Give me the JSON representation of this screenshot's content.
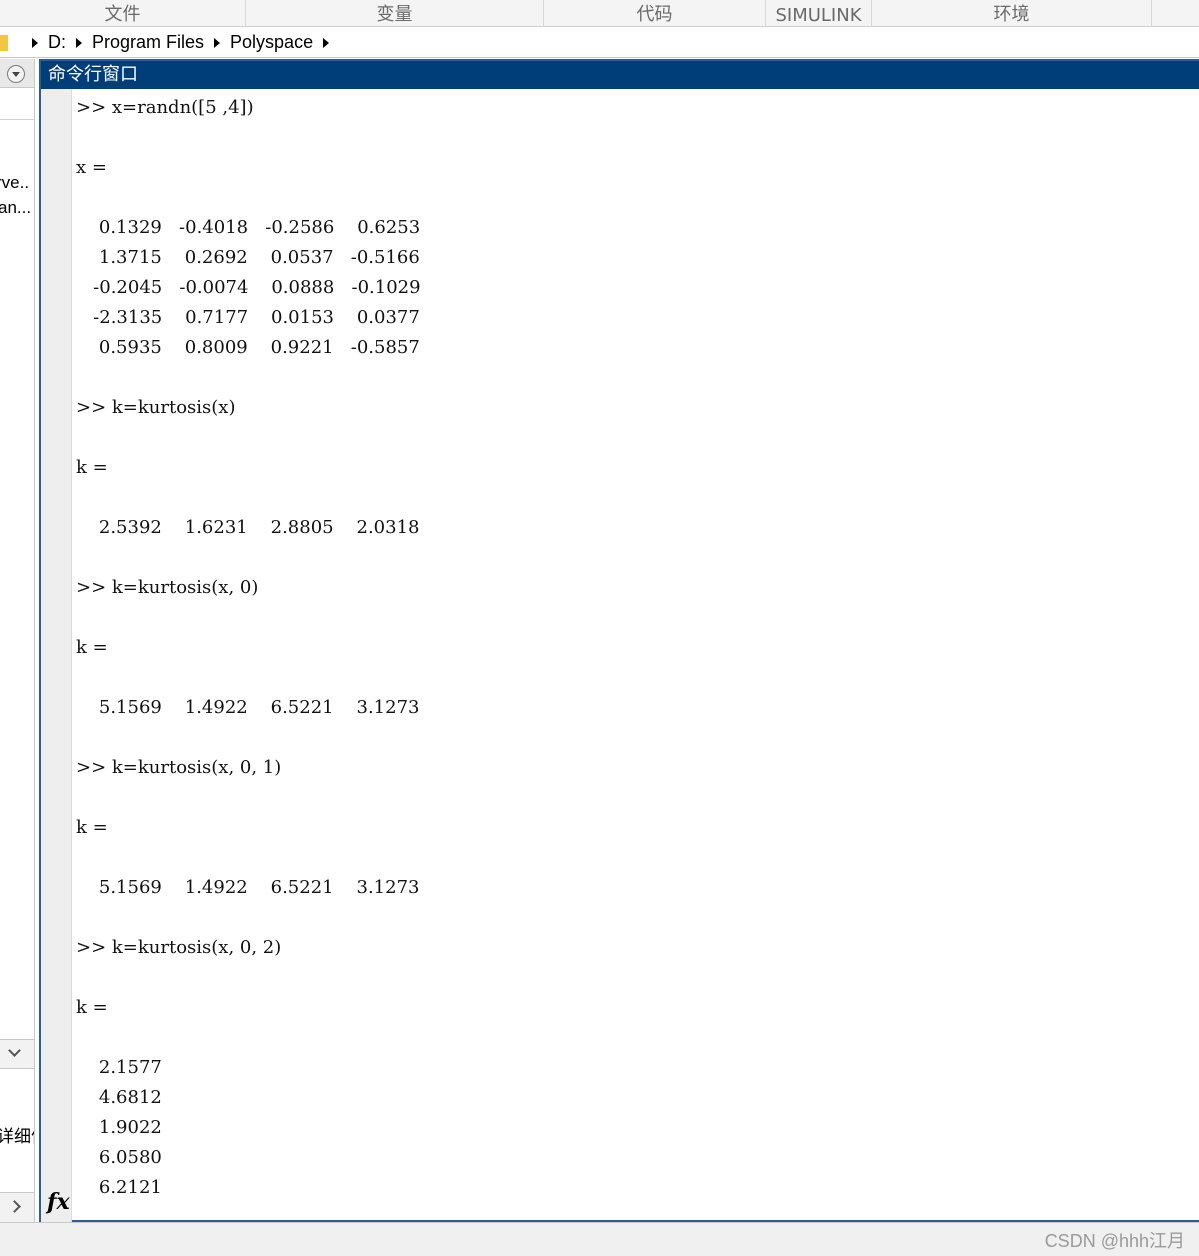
{
  "toolstrip": {
    "sections": [
      "文件",
      "变量",
      "代码",
      "SIMULINK",
      "环境"
    ]
  },
  "path": {
    "segments": [
      "D:",
      "Program Files",
      "Polyspace"
    ]
  },
  "left_panel": {
    "lines": [
      "rve..",
      "an...",
      "详细信"
    ]
  },
  "command_window": {
    "title": "命令行窗口",
    "fx_label": "fx",
    "lines": [
      ">> x=randn([5 ,4])",
      "",
      "x =",
      "",
      "    0.1329   -0.4018   -0.2586    0.6253",
      "    1.3715    0.2692    0.0537   -0.5166",
      "   -0.2045   -0.0074    0.0888   -0.1029",
      "   -2.3135    0.7177    0.0153    0.0377",
      "    0.5935    0.8009    0.9221   -0.5857",
      "",
      ">> k=kurtosis(x)",
      "",
      "k =",
      "",
      "    2.5392    1.6231    2.8805    2.0318",
      "",
      ">> k=kurtosis(x, 0)",
      "",
      "k =",
      "",
      "    5.1569    1.4922    6.5221    3.1273",
      "",
      ">> k=kurtosis(x, 0, 1)",
      "",
      "k =",
      "",
      "    5.1569    1.4922    6.5221    3.1273",
      "",
      ">> k=kurtosis(x, 0, 2)",
      "",
      "k =",
      "",
      "    2.1577",
      "    4.6812",
      "    1.9022",
      "    6.0580",
      "    6.2121"
    ]
  },
  "watermark": "CSDN @hhh江月"
}
